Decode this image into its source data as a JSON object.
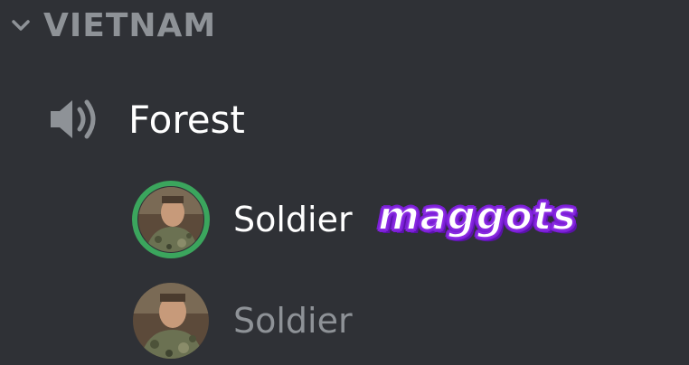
{
  "colors": {
    "background": "#2f3136",
    "category_text": "#8e9297",
    "channel_text": "#ffffff",
    "speaking_ring": "#3ba55d",
    "muted_user_text": "#8e9297",
    "caption_outline": "#7b1fd6"
  },
  "category": {
    "icon": "chevron-down-icon",
    "label": "VIETNAM"
  },
  "channel": {
    "icon": "speaker-icon",
    "name": "Forest"
  },
  "users": [
    {
      "name": "Soldier",
      "speaking": true,
      "avatar": "soldier-avatar"
    },
    {
      "name": "Soldier",
      "speaking": false,
      "avatar": "soldier-avatar"
    }
  ],
  "caption": {
    "text": "maggots"
  }
}
